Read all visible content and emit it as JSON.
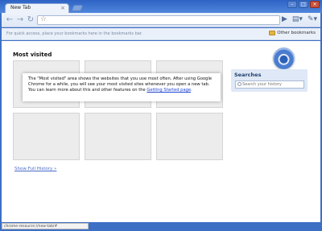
{
  "window": {
    "controls": [
      "–",
      "□",
      "×"
    ]
  },
  "tab": {
    "title": "New Tab",
    "close": "×"
  },
  "toolbar": {
    "back": "←",
    "forward": "→",
    "reload": "↻",
    "star": "☆",
    "go": "▶",
    "page_menu": "▤▾",
    "wrench_menu": "✎▾"
  },
  "bookmarks_bar": {
    "hint": "For quick access, place your bookmarks here in the bookmarks bar.",
    "other": "Other bookmarks"
  },
  "most_visited": {
    "title": "Most visited",
    "info_text": "The \"Most visited\" area shows the websites that you use most often. After using Google Chrome for a while, you will see your most visited sites whenever you open a new tab. You can learn more about this and other features on the ",
    "info_link": "Getting Started page",
    "info_end": "."
  },
  "history_link": "Show Full History »",
  "searches": {
    "title": "Searches",
    "placeholder": "Search your history"
  },
  "status": "chrome-resource://new-tab/#"
}
